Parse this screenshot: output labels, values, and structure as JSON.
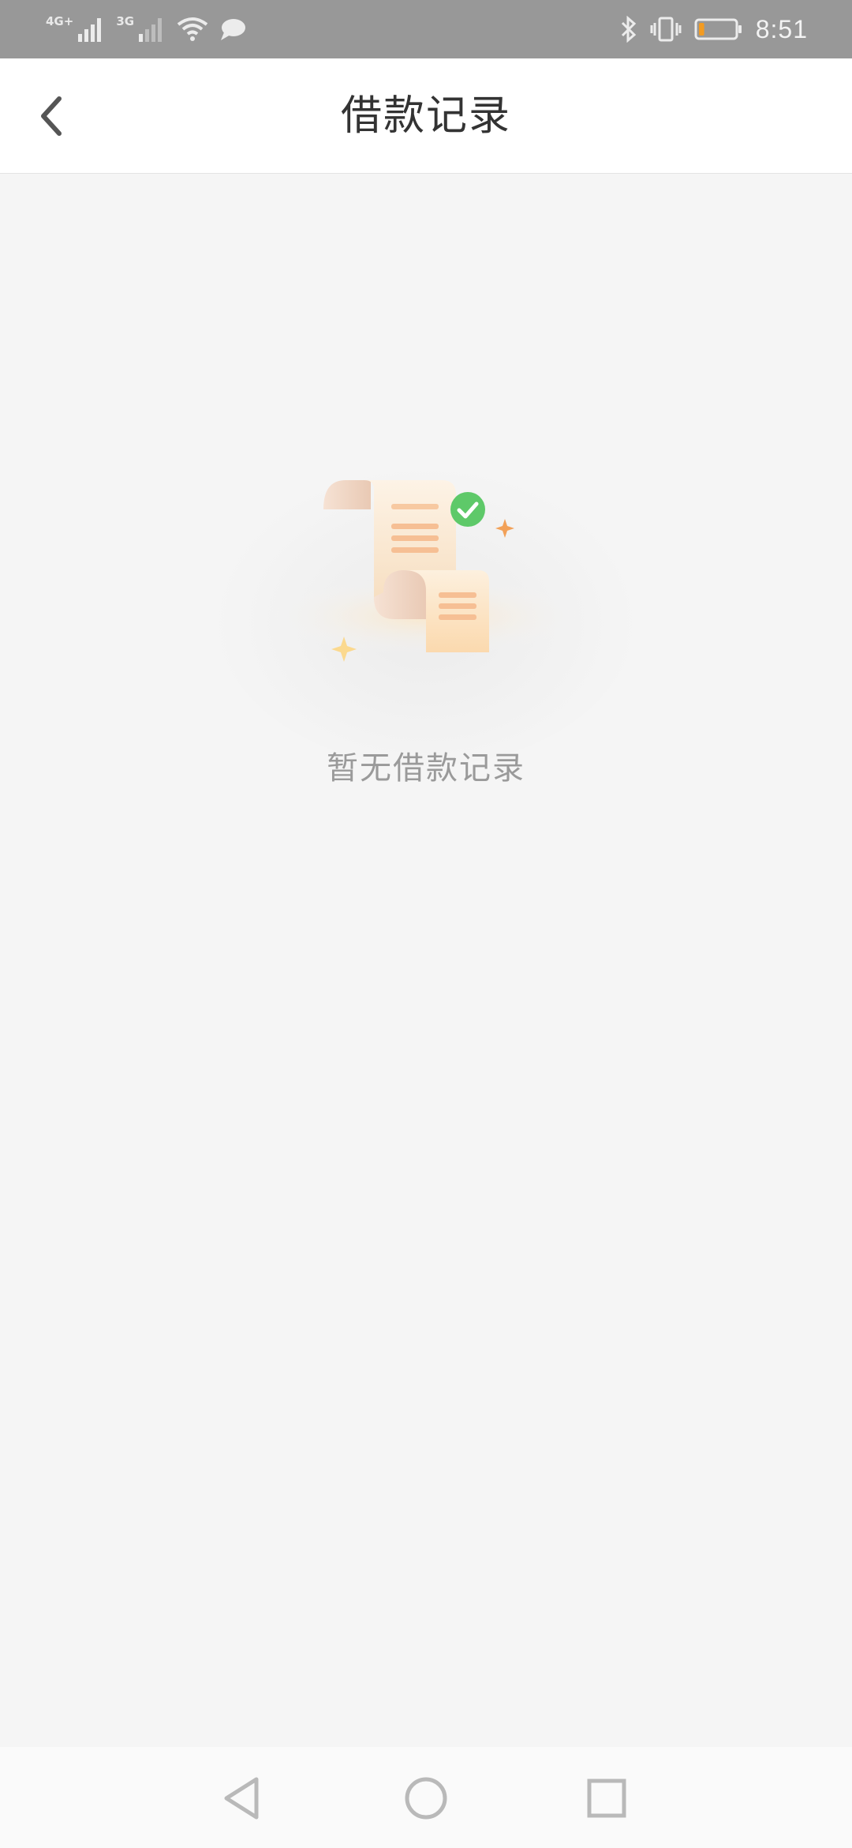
{
  "status_bar": {
    "network_1": "4G+",
    "network_2": "3G",
    "time": "8:51",
    "icons": [
      "signal-icon",
      "wifi-icon",
      "message-icon",
      "bluetooth-icon",
      "vibrate-icon",
      "battery-icon"
    ],
    "battery_level": 0.15,
    "battery_color": "#f39b21"
  },
  "header": {
    "title": "借款记录",
    "back_icon": "chevron-left-icon"
  },
  "empty_state": {
    "message": "暂无借款记录",
    "illustration": "receipt-scroll-illustration",
    "check_color": "#5ec969"
  },
  "nav_bar": {
    "buttons": [
      "back-triangle-icon",
      "home-circle-icon",
      "recents-square-icon"
    ]
  }
}
